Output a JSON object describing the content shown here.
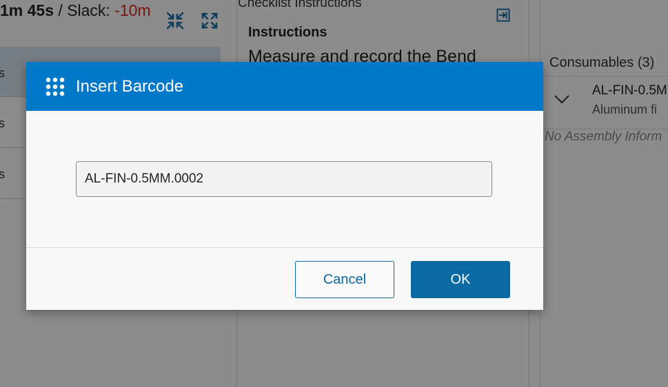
{
  "timer": {
    "elapsed": "1m 45s",
    "separator": " / ",
    "slack_label": "Slack: ",
    "slack_value": "-10m"
  },
  "toolbar": {
    "collapse_icon": "collapse-arrows-icon",
    "expand_icon": "expand-arrows-icon"
  },
  "task_list": {
    "rows": [
      {
        "label": "s"
      },
      {
        "label": "s"
      },
      {
        "label": "s"
      }
    ]
  },
  "checklist": {
    "header": "Checklist Instructions",
    "panel_toggle_icon": "panel-exit-icon",
    "instructions_label": "Instructions",
    "instructions_text": "Measure and record the Bend"
  },
  "consumables": {
    "title": "Consumables (3)",
    "item": {
      "code": "AL-FIN-0.5M",
      "description": "Aluminum fi"
    },
    "no_assembly": "No Assembly Inform"
  },
  "dialog": {
    "icon": "keypad-icon",
    "title": "Insert Barcode",
    "input_value": "AL-FIN-0.5MM.0002",
    "cancel_label": "Cancel",
    "ok_label": "OK"
  },
  "colors": {
    "header_blue": "#0178c8",
    "button_blue": "#0a6aa1",
    "slack_red": "#d9251c"
  }
}
